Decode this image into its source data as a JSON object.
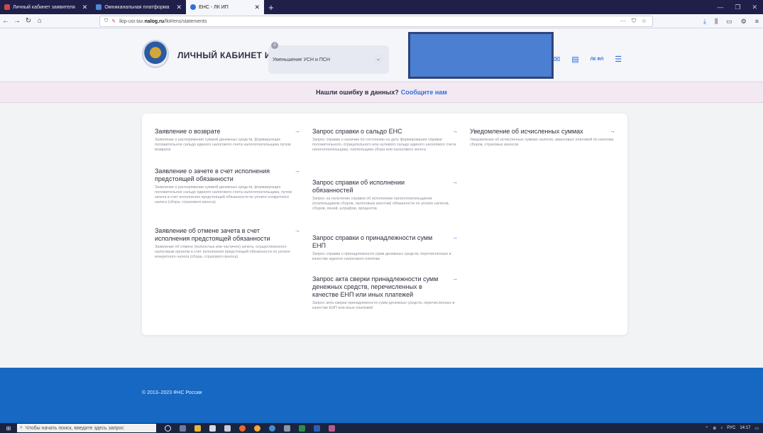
{
  "browser": {
    "tabs": [
      {
        "label": "Личный кабинет заявителя",
        "favicon_color": "#c94a4a",
        "active": false
      },
      {
        "label": "Омниканальная платформа",
        "favicon_color": "#4a8ad1",
        "active": false
      },
      {
        "label": "ЕНС - ЛК ИП",
        "favicon_color": "#2f6fd9",
        "active": true
      }
    ],
    "url_prefix": "lkip-usr.tax.",
    "url_host": "nalog.ru",
    "url_path": "/lk#/ens/statements"
  },
  "header": {
    "title": "ЛИЧНЫЙ КАБИНЕТ ИП",
    "select_value": "Уменьшение УСН и ПСН",
    "badge_count": "0",
    "user_initials": "ЛК ФЛ"
  },
  "banner": {
    "text": "Нашли ошибку в данных?",
    "link": "Сообщите нам"
  },
  "statements": [
    {
      "title": "Заявление о возврате",
      "desc": "Заявление о распоряжении суммой денежных средств, формирующих положительное сальдо единого налогового счета налогоплательщика путем возврата"
    },
    {
      "title": "Заявление о зачете в счет исполнения предстоящей обязанности",
      "desc": "Заявление о распоряжении суммой денежных средств, формирующих положительное сальдо единого налогового счета налогоплательщика, путем зачета в счет исполнения предстоящей обязанности по уплате конкретного налога (сбора, страхового взноса)"
    },
    {
      "title": "Заявление об отмене зачета в счет исполнения предстоящей обязанности",
      "desc": "Заявление об отмене (полностью или частично) зачета, осуществленного налоговым органом в счет исполнения предстоящей обязанности по уплате конкретного налога (сбора, страхового взноса)"
    },
    {
      "title": "Запрос справки о сальдо ЕНС",
      "desc": "Запрос справки о наличии по состоянию на дату формирования справки положительного, отрицательного или нулевого сальдо единого налогового счета налогоплательщика, плательщика сбора или налогового агента"
    },
    {
      "title": "Запрос справки об исполнении обязанностей",
      "desc": "Запрос на получение справки об исполнении налогоплательщиком (плательщиком сборов, налоговым агентом) обязанности по уплате налогов, сборов, пеней, штрафов, процентов"
    },
    {
      "title": "Запрос справки о принадлежности сумм ЕНП",
      "desc": "Запрос справки о принадлежности сумм денежных средств, перечисленных в качестве единого налогового платежа"
    },
    {
      "title": "Запрос акта сверки принадлежности сумм денежных средств, перечисленных в качестве ЕНП или иных платежей",
      "desc": "Запрос акта сверки принадлежности сумм денежных средств, перечисленных в качестве ЕНП или иных платежей"
    },
    {
      "title": "Уведомление об исчисленных суммах",
      "desc": "Уведомление об исчисленных суммах налогов, авансовых платежей по налогам, сборов, страховых взносов"
    }
  ],
  "footer": {
    "copyright": "© 2013–2023 ФНС России"
  },
  "taskbar": {
    "search_placeholder": "Чтобы начать поиск, введите здесь запрос",
    "lang": "РУС",
    "time": "14:17"
  },
  "colors": {
    "accent": "#2f6fd9",
    "footer": "#1668c2",
    "banner_bg": "#f2e9f3"
  }
}
